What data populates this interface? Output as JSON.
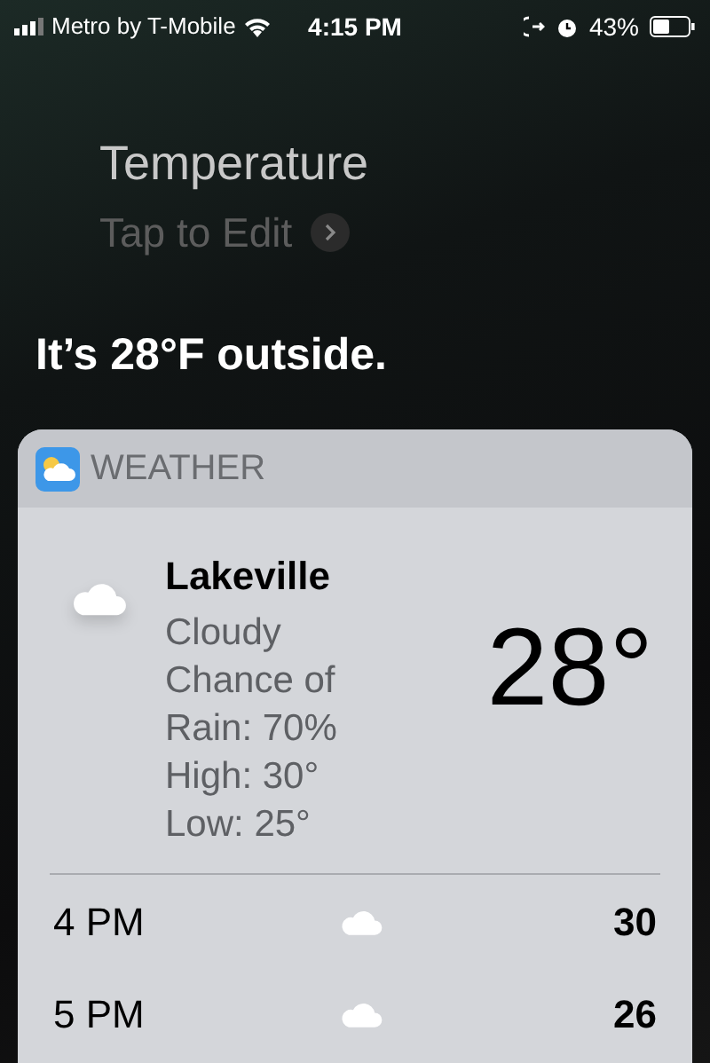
{
  "status_bar": {
    "carrier": "Metro by T-Mobile",
    "time": "4:15 PM",
    "battery": "43%"
  },
  "query": {
    "text": "Temperature",
    "edit_hint": "Tap to Edit"
  },
  "response": "It’s 28°F outside.",
  "card": {
    "app": "WEATHER",
    "location": "Lakeville",
    "details": [
      "Cloudy",
      "Chance of Rain: 70%",
      "High: 30°",
      "Low: 25°"
    ],
    "temperature": "28°",
    "hourly": [
      {
        "time": "4 PM",
        "temp": "30"
      },
      {
        "time": "5 PM",
        "temp": "26"
      }
    ]
  }
}
